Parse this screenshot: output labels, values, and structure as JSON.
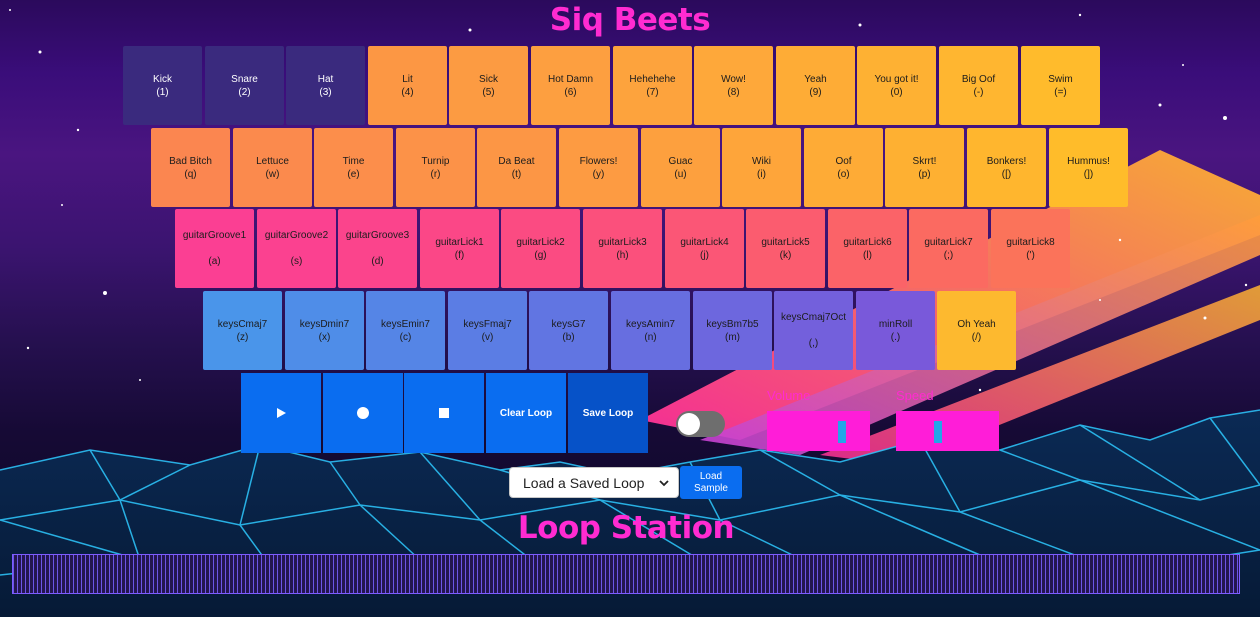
{
  "title": "Siq Beets",
  "loop_title": "Loop Station",
  "pad_rows": [
    [
      {
        "label": "Kick",
        "key": "(1)",
        "color": "#3a2a7e"
      },
      {
        "label": "Snare",
        "key": "(2)",
        "color": "#3a2a7e"
      },
      {
        "label": "Hat",
        "key": "(3)",
        "color": "#3a2a7e"
      },
      {
        "label": "Lit",
        "key": "(4)",
        "color": "#fc9744"
      },
      {
        "label": "Sick",
        "key": "(5)",
        "color": "#fc9b42"
      },
      {
        "label": "Hot Damn",
        "key": "(6)",
        "color": "#fd9f40"
      },
      {
        "label": "Hehehehe",
        "key": "(7)",
        "color": "#fda33d"
      },
      {
        "label": "Wow!",
        "key": "(8)",
        "color": "#fea83a"
      },
      {
        "label": "Yeah",
        "key": "(9)",
        "color": "#feac36"
      },
      {
        "label": "You got it!",
        "key": "(0)",
        "color": "#feb133"
      },
      {
        "label": "Big Oof",
        "key": "(-)",
        "color": "#ffb630"
      },
      {
        "label": "Swim",
        "key": "(=)",
        "color": "#ffbb2c"
      }
    ],
    [
      {
        "label": "Bad Bitch",
        "key": "(q)",
        "color": "#fb8650"
      },
      {
        "label": "Lettuce",
        "key": "(w)",
        "color": "#fb8a4d"
      },
      {
        "label": "Time",
        "key": "(e)",
        "color": "#fc8e4b"
      },
      {
        "label": "Turnip",
        "key": "(r)",
        "color": "#fc9248"
      },
      {
        "label": "Da Beat",
        "key": "(t)",
        "color": "#fc9645"
      },
      {
        "label": "Flowers!",
        "key": "(y)",
        "color": "#fd9b42"
      },
      {
        "label": "Guac",
        "key": "(u)",
        "color": "#fda03e"
      },
      {
        "label": "Wiki",
        "key": "(i)",
        "color": "#fea53a"
      },
      {
        "label": "Oof",
        "key": "(o)",
        "color": "#feab36"
      },
      {
        "label": "Skrrt!",
        "key": "(p)",
        "color": "#feb032"
      },
      {
        "label": "Bonkers!",
        "key": "([)",
        "color": "#ffb62e"
      },
      {
        "label": "Hummus!",
        "key": "(])",
        "color": "#ffbc2a"
      }
    ],
    [
      {
        "label": "guitarGroove1",
        "key": "(a)",
        "color": "#fb3f93",
        "spaced": true
      },
      {
        "label": "guitarGroove2",
        "key": "(s)",
        "color": "#fb4190",
        "spaced": true
      },
      {
        "label": "guitarGroove3",
        "key": "(d)",
        "color": "#fb448c",
        "spaced": true
      },
      {
        "label": "guitarLick1",
        "key": "(f)",
        "color": "#fb4787"
      },
      {
        "label": "guitarLick2",
        "key": "(g)",
        "color": "#fb4b82"
      },
      {
        "label": "guitarLick3",
        "key": "(h)",
        "color": "#fb507c"
      },
      {
        "label": "guitarLick4",
        "key": "(j)",
        "color": "#fb5676"
      },
      {
        "label": "guitarLick5",
        "key": "(k)",
        "color": "#fb5c6f"
      },
      {
        "label": "guitarLick6",
        "key": "(l)",
        "color": "#fb6368"
      },
      {
        "label": "guitarLick7",
        "key": "(;)",
        "color": "#fb6a61"
      },
      {
        "label": "guitarLick8",
        "key": "(')",
        "color": "#fb735a"
      }
    ],
    [
      {
        "label": "keysCmaj7",
        "key": "(z)",
        "color": "#4a95ea"
      },
      {
        "label": "keysDmin7",
        "key": "(x)",
        "color": "#4f8de8"
      },
      {
        "label": "keysEmin7",
        "key": "(c)",
        "color": "#5585e6"
      },
      {
        "label": "keysFmaj7",
        "key": "(v)",
        "color": "#5b7de4"
      },
      {
        "label": "keysG7",
        "key": "(b)",
        "color": "#6175e2"
      },
      {
        "label": "keysAmin7",
        "key": "(n)",
        "color": "#676ee0"
      },
      {
        "label": "keysBm7b5",
        "key": "(m)",
        "color": "#6d67de"
      },
      {
        "label": "keysCmaj7Oct",
        "key": "(,)",
        "color": "#7360dc",
        "spaced": true
      },
      {
        "label": "minRoll",
        "key": "(.)",
        "color": "#7959da"
      },
      {
        "label": "Oh Yeah",
        "key": "(/)",
        "color": "#fdb92f"
      }
    ]
  ],
  "controls": {
    "play_icon": "play-icon",
    "record_icon": "record-icon",
    "stop_icon": "stop-icon",
    "clear_label": "Clear Loop",
    "save_label": "Save Loop"
  },
  "volume": {
    "label": "Volume",
    "value": 0.75
  },
  "speed": {
    "label": "Speed",
    "value": 0.4
  },
  "load_select": {
    "selected": "Load a Saved Loop"
  },
  "load_sample": {
    "line1": "Load",
    "line2": "Sample"
  }
}
